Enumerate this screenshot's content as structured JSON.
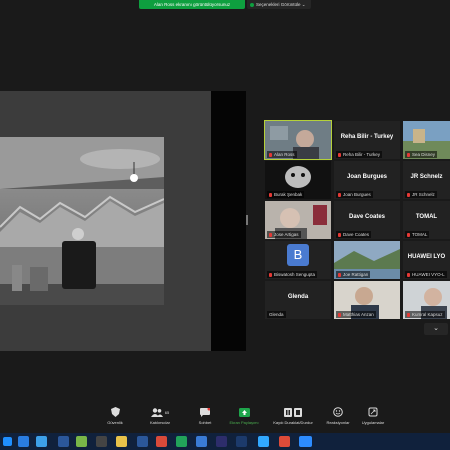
{
  "banner": {
    "text": "Alan Ross ekranını görüntülüyorsunuz"
  },
  "view_options": {
    "label": "Seçenekleri Görüntüle"
  },
  "participants": [
    {
      "name": "Alan Ross",
      "label": "",
      "video": true
    },
    {
      "name": "Reha Bilir - Turkey",
      "label": "Reha Bilir - Turkey",
      "video": false
    },
    {
      "name": "Sea Disney",
      "label": "",
      "video": true
    },
    {
      "name": "Burak Şenbak",
      "label": "",
      "video": true
    },
    {
      "name": "Joan Burgues",
      "label": "Joan Burgues",
      "video": false
    },
    {
      "name": "JR Schnelz",
      "label": "JR Schnelz",
      "video": false
    },
    {
      "name": "Jose Artigas",
      "label": "",
      "video": true
    },
    {
      "name": "Dave Coates",
      "label": "Dave Coates",
      "video": false
    },
    {
      "name": "TOMAL",
      "label": "TOMAL",
      "video": false
    },
    {
      "name": "Biswatosh Sengupta",
      "label": "B",
      "video": false
    },
    {
      "name": "Joe Rattigan",
      "label": "",
      "video": true
    },
    {
      "name": "HUAWEI VYO-L",
      "label": "HUAWEI LYO",
      "video": false
    },
    {
      "name": "Glenda",
      "label": "Glenda",
      "video": false
    },
    {
      "name": "Matthias Anzan",
      "label": "",
      "video": true
    },
    {
      "name": "Kumral Kapsuz",
      "label": "",
      "video": true
    }
  ],
  "toolbar": {
    "security": "Güvenlik",
    "participants": "Katılımcılar",
    "participants_count": "65",
    "chat": "Sohbet",
    "share": "Ekran Paylaşımı",
    "record": "Kaydı Duraklat/Durdur",
    "reactions": "Reaksiyonlar",
    "apps": "Uygulamalar"
  },
  "colors": {
    "green": "#0e9f3f",
    "active_border": "#b5d13a",
    "mic_muted": "#e53935",
    "taskbar": "#10213c"
  }
}
